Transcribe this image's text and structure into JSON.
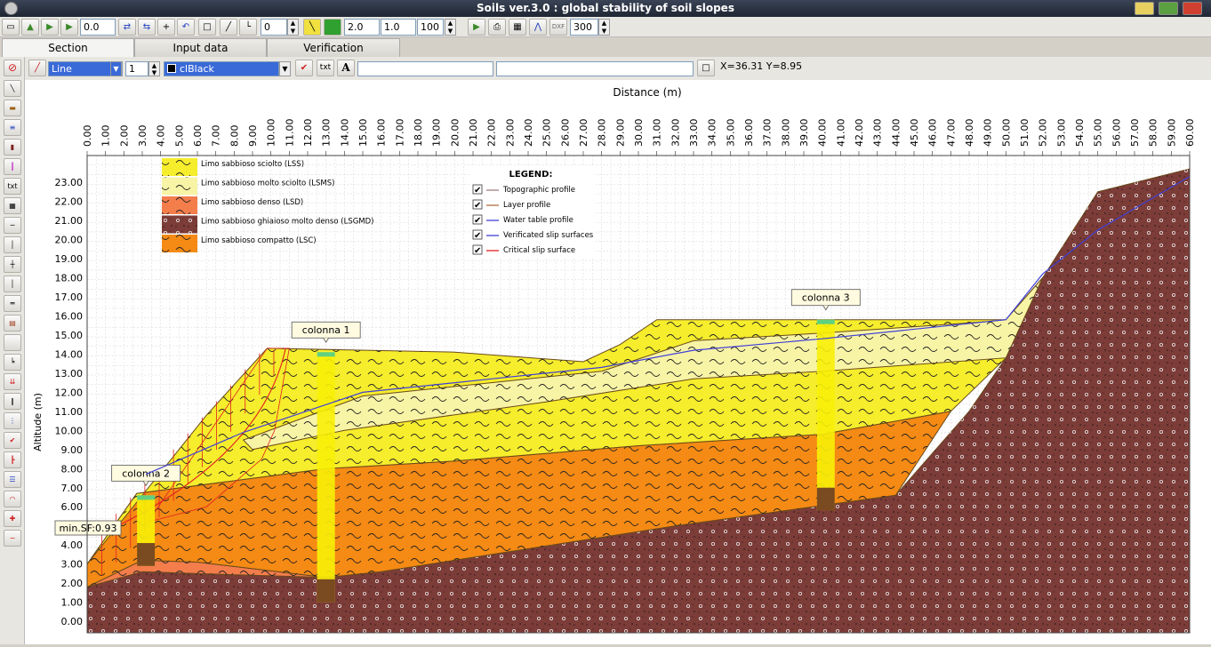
{
  "window": {
    "title": "Soils ver.3.0 : global stability of soil slopes"
  },
  "toolbar": {
    "zoom_value": "0.0",
    "layer_value": "0",
    "scale_a": "2.0",
    "scale_b": "1.0",
    "scale_c": "100",
    "dxf_label": "DXF",
    "dpi_value": "300"
  },
  "tabs": [
    {
      "label": "Section"
    },
    {
      "label": "Input data"
    },
    {
      "label": "Verification"
    }
  ],
  "drawbar": {
    "line_type": "Line",
    "line_width": "1",
    "color": "clBlack",
    "txt_label": "txt",
    "font_label": "A",
    "text_field": "",
    "text_field2": "",
    "coords": "X=36.31 Y=8.95"
  },
  "left_tools": {
    "txt_label": "txt"
  },
  "colors": {
    "lss": "#f6ed2c",
    "lsms": "#f8f4a6",
    "lsd": "#f47d4c",
    "lsgmd": "#7c3c38",
    "lsc": "#f58a14",
    "grid": "#d6d6d6",
    "water": "#4040d8",
    "critical": "#e02020"
  },
  "chart_data": {
    "type": "cross-section",
    "title": "",
    "xlabel": "Distance (m)",
    "ylabel": "Altitude (m)",
    "xlim": [
      0,
      60
    ],
    "ylim": [
      -0.6,
      24.4
    ],
    "x_ticks": [
      "0.00",
      "1.00",
      "2.00",
      "3.00",
      "4.00",
      "5.00",
      "6.00",
      "7.00",
      "8.00",
      "9.00",
      "10.00",
      "11.00",
      "12.00",
      "13.00",
      "14.00",
      "15.00",
      "16.00",
      "17.00",
      "18.00",
      "19.00",
      "20.00",
      "21.00",
      "22.00",
      "23.00",
      "24.00",
      "25.00",
      "26.00",
      "27.00",
      "28.00",
      "29.00",
      "30.00",
      "31.00",
      "32.00",
      "33.00",
      "34.00",
      "35.00",
      "36.00",
      "37.00",
      "38.00",
      "39.00",
      "40.00",
      "41.00",
      "42.00",
      "43.00",
      "44.00",
      "45.00",
      "46.00",
      "47.00",
      "48.00",
      "49.00",
      "50.00",
      "51.00",
      "52.00",
      "53.00",
      "54.00",
      "55.00",
      "56.00",
      "57.00",
      "58.00",
      "59.00",
      "60.00"
    ],
    "y_ticks": [
      "0.00",
      "1.00",
      "2.00",
      "3.00",
      "4.00",
      "5.00",
      "6.00",
      "7.00",
      "8.00",
      "9.00",
      "10.00",
      "11.00",
      "12.00",
      "13.00",
      "14.00",
      "15.00",
      "16.00",
      "17.00",
      "18.00",
      "19.00",
      "20.00",
      "21.00",
      "22.00",
      "23.00"
    ],
    "soil_legend": [
      {
        "label": "Limo sabbioso sciolto (LSS)",
        "color": "#f6ed2c"
      },
      {
        "label": "Limo sabbioso molto sciolto (LSMS)",
        "color": "#f8f4a6"
      },
      {
        "label": "Limo sabbioso denso (LSD)",
        "color": "#f47d4c"
      },
      {
        "label": "Limo sabbioso ghiaioso molto denso (LSGMD)",
        "color": "#7c3c38"
      },
      {
        "label": "Limo sabbioso compatto (LSC)",
        "color": "#f58a14"
      }
    ],
    "legend": {
      "title": "LEGEND:",
      "items": [
        {
          "label": "Topographic profile",
          "color": "#a08080",
          "checked": true
        },
        {
          "label": "Layer profile",
          "color": "#b07040",
          "checked": true
        },
        {
          "label": "Water table profile",
          "color": "#4040d8",
          "checked": true
        },
        {
          "label": "Verificated slip surfaces",
          "color": "#4040d8",
          "checked": true
        },
        {
          "label": "Critical slip surface",
          "color": "#e02020",
          "checked": true
        }
      ]
    },
    "layers": [
      {
        "name": "LSGMD",
        "color": "#7c3c38",
        "points": [
          [
            0,
            1.8
          ],
          [
            3,
            2.6
          ],
          [
            6,
            2.5
          ],
          [
            13,
            2.3
          ],
          [
            16,
            2.6
          ],
          [
            20,
            3.2
          ],
          [
            26,
            4.1
          ],
          [
            32,
            5.0
          ],
          [
            38,
            5.8
          ],
          [
            44,
            6.6
          ],
          [
            48,
            11.0
          ],
          [
            50,
            13.8
          ],
          [
            52,
            18.0
          ],
          [
            55,
            22.5
          ],
          [
            60,
            23.7
          ],
          [
            60,
            -0.6
          ],
          [
            0,
            -0.6
          ]
        ]
      },
      {
        "name": "LSD",
        "color": "#f47d4c",
        "points": [
          [
            0,
            1.8
          ],
          [
            3,
            3.2
          ],
          [
            6,
            3.1
          ],
          [
            13,
            2.3
          ],
          [
            6,
            2.5
          ],
          [
            3,
            2.6
          ]
        ]
      },
      {
        "name": "LSC",
        "color": "#f58a14",
        "points": [
          [
            0,
            3.0
          ],
          [
            2.7,
            6.7
          ],
          [
            13,
            8.0
          ],
          [
            20,
            8.4
          ],
          [
            30,
            9.2
          ],
          [
            40,
            9.8
          ],
          [
            47,
            11.0
          ],
          [
            44,
            6.6
          ],
          [
            38,
            5.8
          ],
          [
            32,
            5.0
          ],
          [
            26,
            4.1
          ],
          [
            20,
            3.2
          ],
          [
            16,
            2.6
          ],
          [
            13,
            2.3
          ],
          [
            6,
            3.1
          ],
          [
            3,
            3.2
          ],
          [
            0,
            1.8
          ]
        ]
      },
      {
        "name": "LSS",
        "color": "#f6ed2c",
        "points": [
          [
            0,
            3.0
          ],
          [
            6.5,
            10.8
          ],
          [
            9.8,
            14.3
          ],
          [
            20,
            14.1
          ],
          [
            27,
            13.6
          ],
          [
            29,
            14.5
          ],
          [
            31,
            15.8
          ],
          [
            36,
            15.8
          ],
          [
            50,
            15.8
          ],
          [
            52,
            18.0
          ],
          [
            50,
            13.8
          ],
          [
            47,
            11.0
          ],
          [
            40,
            9.8
          ],
          [
            30,
            9.2
          ],
          [
            20,
            8.4
          ],
          [
            13,
            8.0
          ],
          [
            2.7,
            6.7
          ]
        ]
      },
      {
        "name": "LSMS",
        "color": "#f8f4a6",
        "points": [
          [
            8.5,
            9.5
          ],
          [
            15,
            11.8
          ],
          [
            22,
            12.5
          ],
          [
            28,
            13.1
          ],
          [
            33,
            14.7
          ],
          [
            40,
            15.1
          ],
          [
            49,
            15.7
          ],
          [
            50,
            15.8
          ],
          [
            52,
            18.0
          ],
          [
            50,
            13.8
          ],
          [
            40,
            13.1
          ],
          [
            33,
            12.7
          ],
          [
            25,
            11.5
          ],
          [
            14,
            10.0
          ],
          [
            9,
            9.0
          ]
        ]
      }
    ],
    "water_table": [
      [
        3.2,
        7.7
      ],
      [
        8.5,
        9.9
      ],
      [
        15,
        12.0
      ],
      [
        22,
        12.7
      ],
      [
        28,
        13.3
      ],
      [
        33,
        14.2
      ],
      [
        40,
        14.8
      ],
      [
        50,
        15.8
      ],
      [
        52,
        18.2
      ],
      [
        55,
        20.5
      ],
      [
        60,
        23.3
      ]
    ],
    "columns": [
      {
        "label": "colonna 1",
        "x": 13.0,
        "top": 14.1
      },
      {
        "label": "colonna 2",
        "x": 3.2,
        "top": 6.6
      },
      {
        "label": "colonna 3",
        "x": 40.2,
        "top": 15.8
      }
    ],
    "min_sf": "min.SF:0.93"
  }
}
